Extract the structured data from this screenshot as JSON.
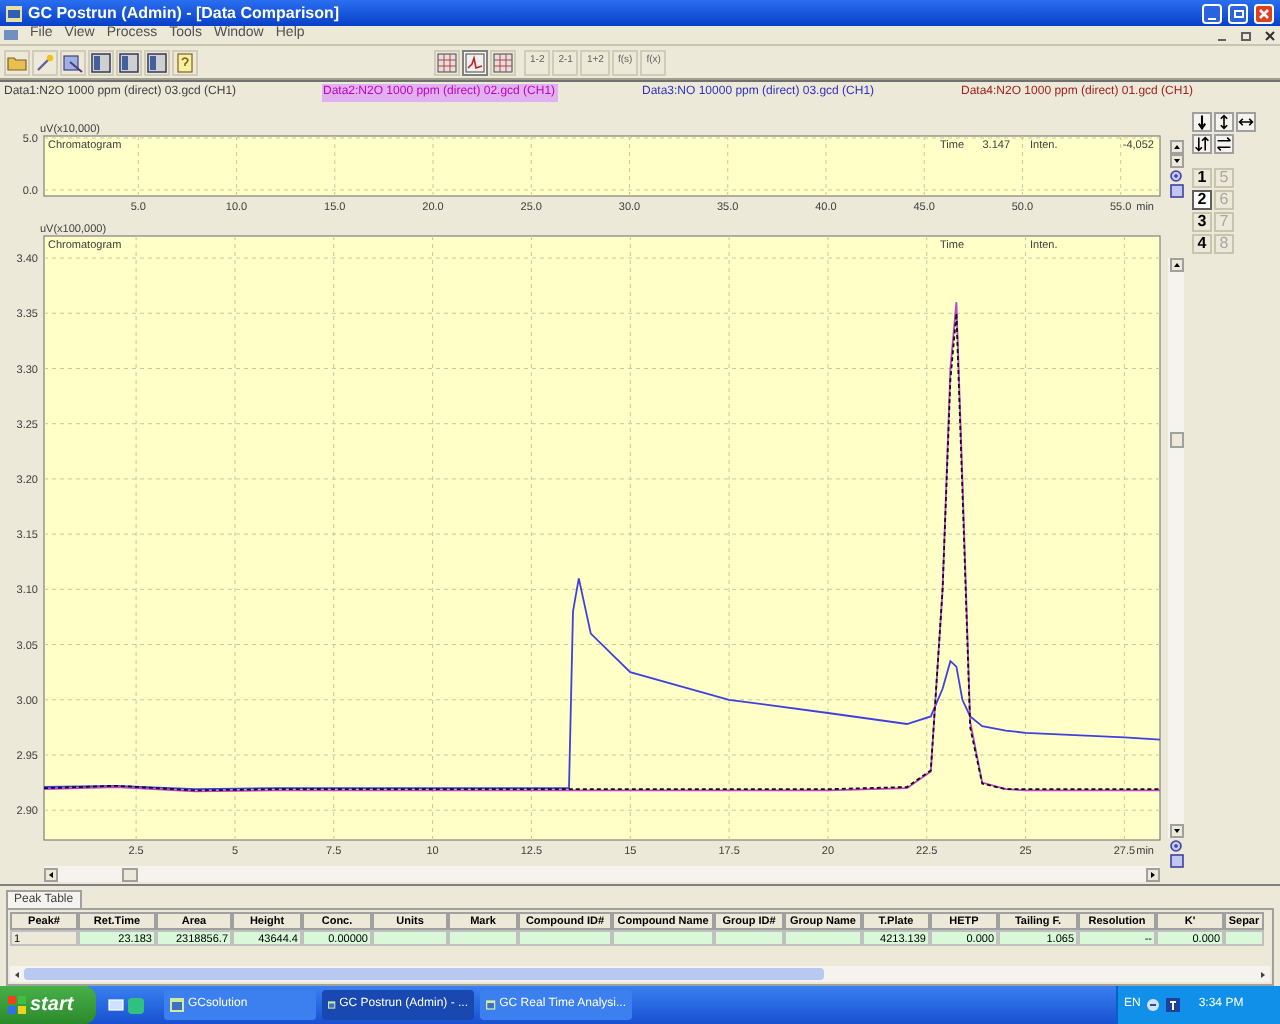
{
  "window": {
    "title": "GC Postrun (Admin) - [Data Comparison]"
  },
  "menu": [
    "File",
    "View",
    "Process",
    "Tools",
    "Window",
    "Help"
  ],
  "toolbar": {
    "icon_buttons": [
      {
        "kind": "folder"
      },
      {
        "kind": "sparkle"
      },
      {
        "kind": "tool"
      },
      {
        "kind": "panel"
      },
      {
        "kind": "panel"
      },
      {
        "kind": "panel"
      },
      {
        "kind": "help"
      }
    ],
    "view_buttons": [
      {
        "kind": "grid",
        "selected": false
      },
      {
        "kind": "chart",
        "selected": true
      },
      {
        "kind": "grid",
        "selected": false
      }
    ],
    "text_buttons": [
      "1-2",
      "2-1",
      "1+2",
      "f(s)",
      "f(x)"
    ]
  },
  "data_headers": [
    {
      "label": "Data1:N2O 1000 ppm (direct) 03.gcd (CH1)",
      "color": "#404040",
      "selected": false
    },
    {
      "label": "Data2:N2O 1000 ppm (direct) 02.gcd (CH1)",
      "color": "#c000c0",
      "selected": true
    },
    {
      "label": "Data3:NO 10000 ppm (direct)  03.gcd (CH1)",
      "color": "#3030c0",
      "selected": false
    },
    {
      "label": "Data4:N2O 1000 ppm (direct) 01.gcd (CH1)",
      "color": "#a02020",
      "selected": false
    }
  ],
  "overview_chart": {
    "title_label": "Chromatogram",
    "time_label": "Time",
    "time_value": "3.147",
    "inten_label": "Inten.",
    "inten_value": "-4,052",
    "chart_data": {
      "type": "line",
      "grid": true,
      "xlabel": "min",
      "ylabel": "uV(x10,000)",
      "xlim": [
        0.2,
        57
      ],
      "ylim": [
        -0.58,
        5.19
      ],
      "xticks": [
        {
          "value": 5,
          "label": "5.0"
        },
        {
          "value": 10,
          "label": "10.0"
        },
        {
          "value": 15,
          "label": "15.0"
        },
        {
          "value": 20,
          "label": "20.0"
        },
        {
          "value": 25,
          "label": "25.0"
        },
        {
          "value": 30,
          "label": "30.0"
        },
        {
          "value": 35,
          "label": "35.0"
        },
        {
          "value": 40,
          "label": "40.0"
        },
        {
          "value": 45,
          "label": "45.0"
        },
        {
          "value": 50,
          "label": "50.0"
        },
        {
          "value": 55,
          "label": "55.0"
        }
      ],
      "yticks": [
        {
          "value": 5,
          "label": "5.0"
        },
        {
          "value": 0,
          "label": "0.0"
        }
      ]
    }
  },
  "main_chart": {
    "title_label": "Chromatogram",
    "time_label": "Time",
    "inten_label": "Inten.",
    "chart_data": {
      "type": "line",
      "grid": true,
      "xlabel": "min",
      "ylabel": "uV(x100,000)",
      "xlim": [
        0.17,
        28.4
      ],
      "ylim": [
        2.873,
        3.42
      ],
      "xticks": [
        2.5,
        5,
        7.5,
        10,
        12.5,
        15,
        17.5,
        20,
        22.5,
        25,
        27.5
      ],
      "yticks": [
        {
          "value": 3.4,
          "label": "3.40"
        },
        {
          "value": 3.35,
          "label": "3.35"
        },
        {
          "value": 3.3,
          "label": "3.30"
        },
        {
          "value": 3.25,
          "label": "3.25"
        },
        {
          "value": 3.2,
          "label": "3.20"
        },
        {
          "value": 3.15,
          "label": "3.15"
        },
        {
          "value": 3.1,
          "label": "3.10"
        },
        {
          "value": 3.05,
          "label": "3.05"
        },
        {
          "value": 3.0,
          "label": "3.00"
        },
        {
          "value": 2.95,
          "label": "2.95"
        },
        {
          "value": 2.9,
          "label": "2.90"
        }
      ],
      "x": [
        0.17,
        2,
        4,
        6,
        8,
        10,
        12,
        13.45,
        13.55,
        13.7,
        14,
        15,
        17.5,
        20,
        22,
        22.6,
        22.9,
        23.1,
        23.25,
        23.4,
        23.6,
        23.9,
        24.5,
        25,
        27.5,
        28.4
      ],
      "series": [
        {
          "color": "#4040e0",
          "line_style": "solid",
          "values": [
            2.921,
            2.922,
            2.919,
            2.92,
            2.92,
            2.92,
            2.92,
            2.92,
            3.08,
            3.11,
            3.06,
            3.025,
            3.0,
            2.988,
            2.978,
            2.985,
            3.01,
            3.035,
            3.03,
            3.0,
            2.985,
            2.976,
            2.972,
            2.97,
            2.966,
            2.964
          ]
        },
        {
          "color": "#c040d0",
          "line_style": "solid",
          "values": [
            2.919,
            2.921,
            2.917,
            2.918,
            2.918,
            2.918,
            2.918,
            2.918,
            2.918,
            2.918,
            2.918,
            2.918,
            2.918,
            2.918,
            2.92,
            2.935,
            3.1,
            3.3,
            3.36,
            3.2,
            2.98,
            2.925,
            2.919,
            2.918,
            2.918,
            2.918
          ]
        },
        {
          "color": "#101010",
          "line_style": "dashed",
          "values": [
            2.92,
            2.922,
            2.918,
            2.919,
            2.919,
            2.919,
            2.919,
            2.919,
            2.919,
            2.919,
            2.919,
            2.919,
            2.919,
            2.919,
            2.921,
            2.936,
            3.1,
            3.29,
            3.35,
            3.19,
            2.975,
            2.924,
            2.919,
            2.919,
            2.919,
            2.919
          ]
        }
      ]
    }
  },
  "side_panel": {
    "arrow_buttons": [
      {
        "kind": "down"
      },
      {
        "kind": "updown"
      },
      {
        "kind": "leftright"
      },
      {
        "kind": "swap-vertical"
      },
      {
        "kind": "swap-horizontal"
      }
    ],
    "number_buttons": [
      {
        "label": "1",
        "selected": false,
        "disabled": false
      },
      {
        "label": "5",
        "selected": false,
        "disabled": true
      },
      {
        "label": "2",
        "selected": true,
        "disabled": false
      },
      {
        "label": "6",
        "selected": false,
        "disabled": true
      },
      {
        "label": "3",
        "selected": false,
        "disabled": false
      },
      {
        "label": "7",
        "selected": false,
        "disabled": true
      },
      {
        "label": "4",
        "selected": false,
        "disabled": false
      },
      {
        "label": "8",
        "selected": false,
        "disabled": true
      }
    ]
  },
  "peak_table": {
    "tab": "Peak Table",
    "columns": [
      "Peak#",
      "Ret.Time",
      "Area",
      "Height",
      "Conc.",
      "Units",
      "Mark",
      "Compound ID#",
      "Compound Name",
      "Group ID#",
      "Group Name",
      "T.Plate",
      "HETP",
      "Tailing F.",
      "Resolution",
      "K'",
      "Separ"
    ],
    "rows": [
      [
        "1",
        "23.183",
        "2318856.7",
        "43644.4",
        "0.00000",
        null,
        null,
        null,
        null,
        null,
        null,
        "4213.139",
        "0.000",
        "1.065",
        "--",
        "0.000",
        null
      ]
    ]
  },
  "taskbar": {
    "start": "start",
    "tasks": [
      {
        "label": "GCsolution",
        "selected": false
      },
      {
        "label": "GC Postrun (Admin) - ...",
        "selected": true
      },
      {
        "label": "GC Real Time Analysi...",
        "selected": false
      }
    ],
    "language": "EN",
    "clock": "3:34 PM"
  }
}
